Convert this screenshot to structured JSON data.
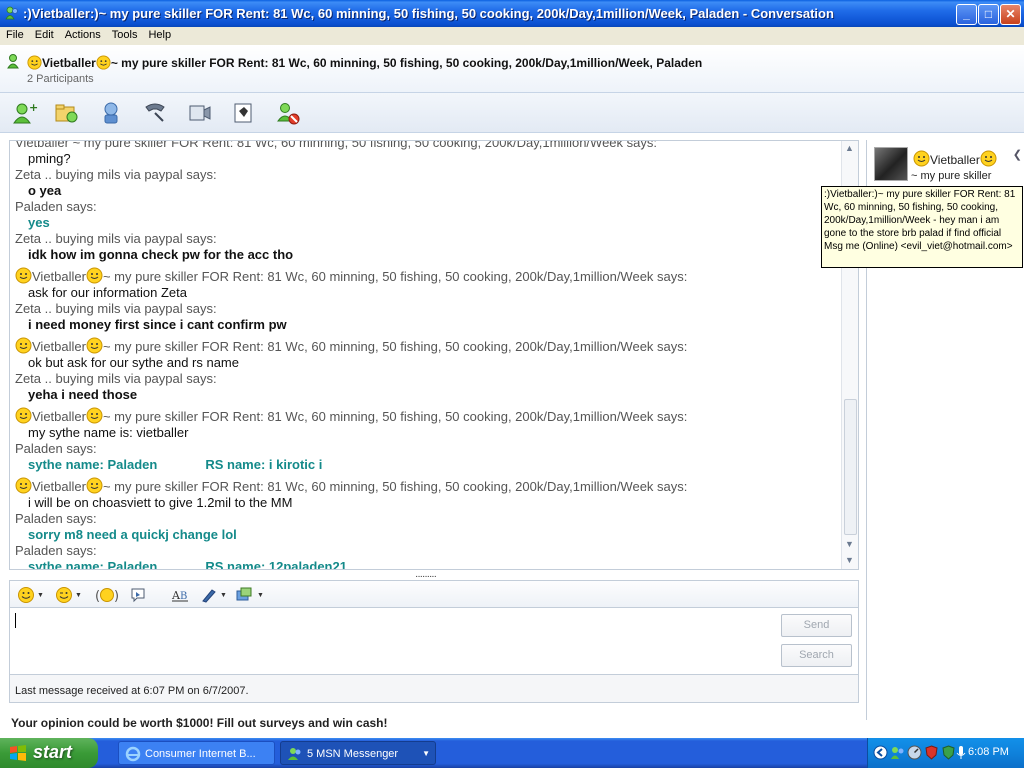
{
  "window": {
    "title": ":)Vietballer:)~   my pure skiller  FOR Rent: 81 Wc, 60 minning,  50 fishing, 50 cooking, 200k/Day,1million/Week, Paladen - Conversation",
    "controls": {
      "minimize": "_",
      "maximize": "□",
      "close": "✕"
    }
  },
  "menu": [
    "File",
    "Edit",
    "Actions",
    "Tools",
    "Help"
  ],
  "header": {
    "contact_name": "Vietballer",
    "title_suffix": "~   my pure skiller  FOR Rent: 81 Wc, 60 minning,  50 fishing, 50 cooking, 200k/Day,1million/Week, Paladen",
    "participants": "2 Participants"
  },
  "toolbar_icons": [
    "invite-contact-icon",
    "send-files-icon",
    "voice-icon",
    "phone-icon",
    "video-icon",
    "activities-icon",
    "block-icon"
  ],
  "messages": [
    {
      "type": "says",
      "text": "Vietballer  ~   my pure skiller  FOR Rent: 81 Wc, 60 minning,  50 fishing, 50 cooking, 200k/Day,1million/Week says:"
    },
    {
      "type": "text",
      "style": "normal",
      "text": "pming?"
    },
    {
      "type": "says",
      "text": "Zeta .. buying mils via paypal says:"
    },
    {
      "type": "text",
      "style": "bold",
      "text": "o yea"
    },
    {
      "type": "says",
      "text": "Paladen says:"
    },
    {
      "type": "text",
      "style": "teal",
      "text": "yes"
    },
    {
      "type": "says",
      "text": "Zeta .. buying mils via paypal says:"
    },
    {
      "type": "text",
      "style": "bold",
      "text": "idk how im gonna check pw for the acc tho"
    },
    {
      "type": "viet",
      "name": "Vietballer",
      "rest": "~   my pure skiller  FOR Rent: 81 Wc, 60 minning,  50 fishing, 50 cooking, 200k/Day,1million/Week says:"
    },
    {
      "type": "text",
      "style": "normal",
      "text": "ask for our information Zeta"
    },
    {
      "type": "says",
      "text": "Zeta .. buying mils via paypal says:"
    },
    {
      "type": "text",
      "style": "bold",
      "text": "i need money first since i cant confirm pw"
    },
    {
      "type": "viet",
      "name": "Vietballer",
      "rest": "~   my pure skiller  FOR Rent: 81 Wc, 60 minning,  50 fishing, 50 cooking, 200k/Day,1million/Week says:"
    },
    {
      "type": "text",
      "style": "normal",
      "text": "ok but ask for our sythe and rs name"
    },
    {
      "type": "says",
      "text": "Zeta .. buying mils via paypal says:"
    },
    {
      "type": "text",
      "style": "bold",
      "text": "yeha i need those"
    },
    {
      "type": "viet",
      "name": "Vietballer",
      "rest": "~   my pure skiller  FOR Rent: 81 Wc, 60 minning,  50 fishing, 50 cooking, 200k/Day,1million/Week says:"
    },
    {
      "type": "text",
      "style": "normal",
      "text": "my sythe name is: vietballer"
    },
    {
      "type": "says",
      "text": "Paladen says:"
    },
    {
      "type": "pair",
      "a": "sythe name: Paladen",
      "b": "RS name: i kirotic i"
    },
    {
      "type": "viet",
      "name": "Vietballer",
      "rest": "~   my pure skiller  FOR Rent: 81 Wc, 60 minning,  50 fishing, 50 cooking, 200k/Day,1million/Week says:"
    },
    {
      "type": "text",
      "style": "normal",
      "text": "i will be on choasviett to give 1.2mil to the MM"
    },
    {
      "type": "says",
      "text": "Paladen says:"
    },
    {
      "type": "text",
      "style": "teal",
      "text": "sorry m8 need a quickj change lol"
    },
    {
      "type": "says",
      "text": "Paladen says:"
    },
    {
      "type": "pair",
      "a": "sythe name: Paladen",
      "b": "RS name: 12paladen21"
    }
  ],
  "splitter": "·········",
  "format_icons": [
    "emoticon-icon",
    "wink-icon",
    "nudge-icon",
    "voice-clip-icon",
    "font-icon",
    "background-icon",
    "ink-icon"
  ],
  "buttons": {
    "send": "Send",
    "search": "Search"
  },
  "status": "Last message received at 6:07 PM on 6/7/2007.",
  "ad": "Your opinion could be worth $1000! Fill out surveys and win cash!",
  "side_panel": {
    "name": "Vietballer",
    "sub": "~   my pure skiller",
    "collapse": "❮"
  },
  "tooltip": ":)Vietballer:)~   my pure skiller  FOR Rent: 81 Wc, 60 minning,  50 fishing, 50 cooking, 200k/Day,1million/Week - hey man i am gone to the store brb palad if find official Msg me (Online) <evil_viet@hotmail.com>",
  "taskbar": {
    "start": "start",
    "tasks": [
      "Consumer Internet B...",
      "5 MSN Messenger"
    ],
    "clock": "6:08 PM"
  },
  "colors": {
    "teal": "#148a8a",
    "titlebar": "#0a4fd0",
    "tooltip_bg": "#ffffe1"
  }
}
